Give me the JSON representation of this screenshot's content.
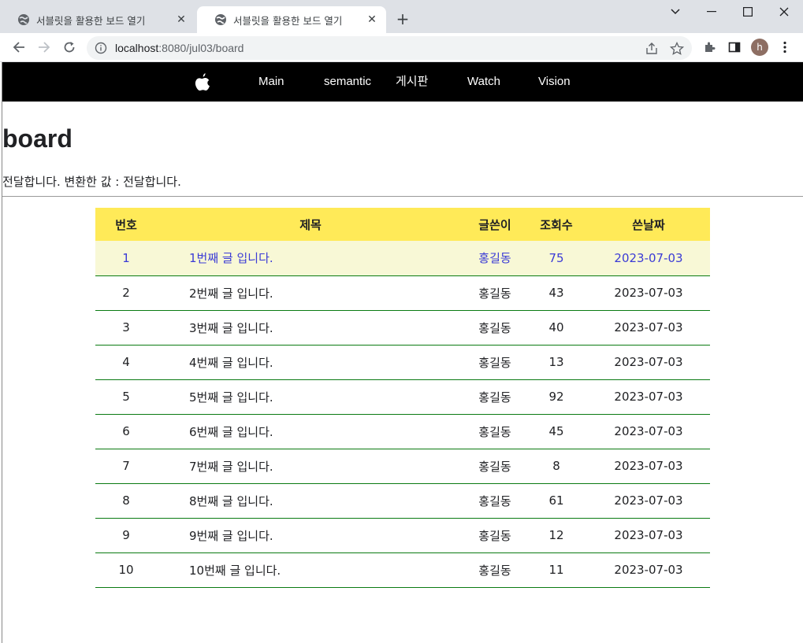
{
  "browser": {
    "tabs": [
      {
        "title": "서블릿을 활용한 보드 열기",
        "active": false
      },
      {
        "title": "서블릿을 활용한 보드 열기",
        "active": true
      }
    ],
    "new_tab": "+",
    "url_host": "localhost",
    "url_rest": ":8080/jul03/board",
    "avatar_letter": "h"
  },
  "nav": {
    "logo": "apple-icon",
    "links": [
      "Main",
      "semantic",
      "게시판",
      "Watch",
      "Vision"
    ]
  },
  "page": {
    "title": "board",
    "message": "전달합니다. 변환한 값 : 전달합니다."
  },
  "table": {
    "headers": [
      "번호",
      "제목",
      "글쓴이",
      "조회수",
      "쓴날짜"
    ],
    "rows": [
      [
        "1",
        "1번째 글 입니다.",
        "홍길동",
        "75",
        "2023-07-03"
      ],
      [
        "2",
        "2번째 글 입니다.",
        "홍길동",
        "43",
        "2023-07-03"
      ],
      [
        "3",
        "3번째 글 입니다.",
        "홍길동",
        "40",
        "2023-07-03"
      ],
      [
        "4",
        "4번째 글 입니다.",
        "홍길동",
        "13",
        "2023-07-03"
      ],
      [
        "5",
        "5번째 글 입니다.",
        "홍길동",
        "92",
        "2023-07-03"
      ],
      [
        "6",
        "6번째 글 입니다.",
        "홍길동",
        "45",
        "2023-07-03"
      ],
      [
        "7",
        "7번째 글 입니다.",
        "홍길동",
        "8",
        "2023-07-03"
      ],
      [
        "8",
        "8번째 글 입니다.",
        "홍길동",
        "61",
        "2023-07-03"
      ],
      [
        "9",
        "9번째 글 입니다.",
        "홍길동",
        "12",
        "2023-07-03"
      ],
      [
        "10",
        "10번째 글 입니다.",
        "홍길동",
        "11",
        "2023-07-03"
      ]
    ]
  },
  "colors": {
    "header_bg": "#ffea58",
    "hover_row_bg": "#f8f8d6",
    "hover_row_text": "#3b3bd6",
    "row_border": "#0a7a12",
    "nav_bg": "#000000"
  }
}
